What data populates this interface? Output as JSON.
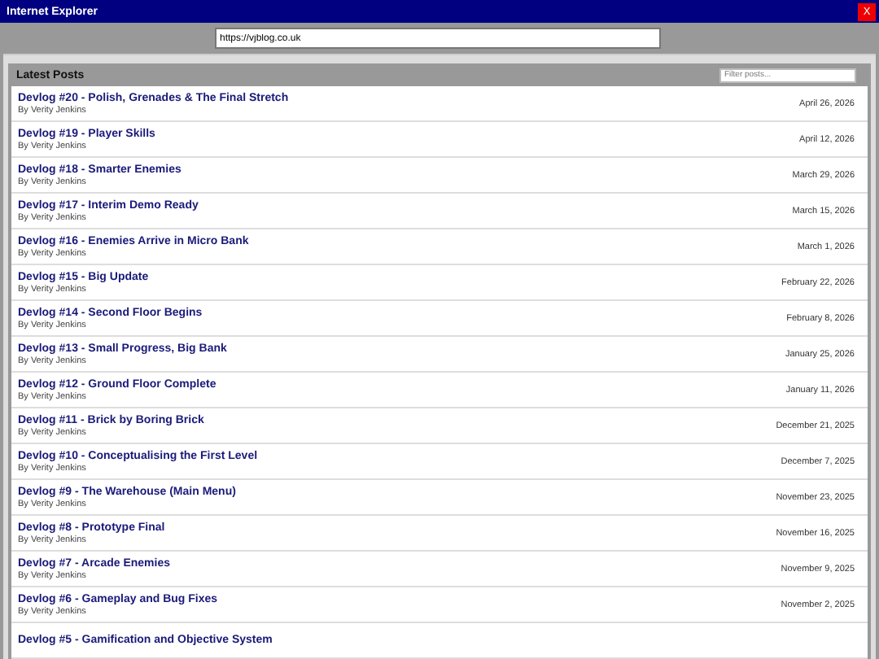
{
  "window": {
    "title": "Internet Explorer",
    "close": "X"
  },
  "address_bar": {
    "value": "https://vjblog.co.uk"
  },
  "panel": {
    "title": "Latest Posts",
    "filter": {
      "placeholder": "Filter posts..."
    }
  },
  "posts": [
    {
      "title": "Devlog #20 - Polish, Grenades & The Final Stretch",
      "author": "By Verity Jenkins",
      "date": "April 26, 2026"
    },
    {
      "title": "Devlog #19 - Player Skills",
      "author": "By Verity Jenkins",
      "date": "April 12, 2026"
    },
    {
      "title": "Devlog #18 - Smarter Enemies",
      "author": "By Verity Jenkins",
      "date": "March 29, 2026"
    },
    {
      "title": "Devlog #17 - Interim Demo Ready",
      "author": "By Verity Jenkins",
      "date": "March 15, 2026"
    },
    {
      "title": "Devlog #16 - Enemies Arrive in Micro Bank",
      "author": "By Verity Jenkins",
      "date": "March 1, 2026"
    },
    {
      "title": "Devlog #15 - Big Update",
      "author": "By Verity Jenkins",
      "date": "February 22, 2026"
    },
    {
      "title": "Devlog #14 - Second Floor Begins",
      "author": "By Verity Jenkins",
      "date": "February 8, 2026"
    },
    {
      "title": "Devlog #13 - Small Progress, Big Bank",
      "author": "By Verity Jenkins",
      "date": "January 25, 2026"
    },
    {
      "title": "Devlog #12 - Ground Floor Complete",
      "author": "By Verity Jenkins",
      "date": "January 11, 2026"
    },
    {
      "title": "Devlog #11 - Brick by Boring Brick",
      "author": "By Verity Jenkins",
      "date": "December 21, 2025"
    },
    {
      "title": "Devlog #10 - Conceptualising the First Level",
      "author": "By Verity Jenkins",
      "date": "December 7, 2025"
    },
    {
      "title": "Devlog #9 - The Warehouse (Main Menu)",
      "author": "By Verity Jenkins",
      "date": "November 23, 2025"
    },
    {
      "title": "Devlog #8 - Prototype Final",
      "author": "By Verity Jenkins",
      "date": "November 16, 2025"
    },
    {
      "title": "Devlog #7 - Arcade Enemies",
      "author": "By Verity Jenkins",
      "date": "November 9, 2025"
    },
    {
      "title": "Devlog #6 - Gameplay and Bug Fixes",
      "author": "By Verity Jenkins",
      "date": "November 2, 2025"
    },
    {
      "title": "Devlog #5 - Gamification and Objective System"
    }
  ]
}
